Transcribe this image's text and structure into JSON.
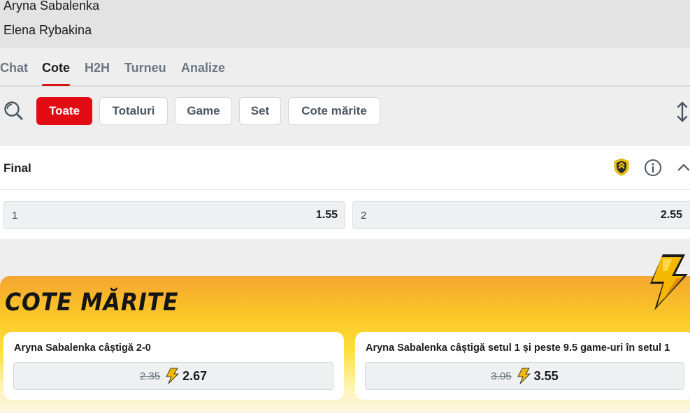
{
  "match": {
    "player1": "Aryna Sabalenka",
    "player2": "Elena Rybakina"
  },
  "tabs": [
    {
      "label": "Chat",
      "active": false
    },
    {
      "label": "Cote",
      "active": true
    },
    {
      "label": "H2H",
      "active": false
    },
    {
      "label": "Turneu",
      "active": false
    },
    {
      "label": "Analize",
      "active": false
    }
  ],
  "filters": [
    {
      "label": "Toate",
      "active": true
    },
    {
      "label": "Totaluri",
      "active": false
    },
    {
      "label": "Game",
      "active": false
    },
    {
      "label": "Set",
      "active": false
    },
    {
      "label": "Cote mărite",
      "active": false
    }
  ],
  "market": {
    "title": "Final",
    "selections": [
      {
        "label": "1",
        "odd": "1.55"
      },
      {
        "label": "2",
        "odd": "2.55"
      }
    ]
  },
  "boosted": {
    "title": "COTE MĂRITE",
    "cards": [
      {
        "title": "Aryna Sabalenka câștigă 2-0",
        "old_odd": "2.35",
        "new_odd": "2.67"
      },
      {
        "title": "Aryna Sabalenka câștigă setul 1 și peste 9.5 game-uri în setul 1",
        "old_odd": "3.05",
        "new_odd": "3.55"
      }
    ]
  },
  "icons": {
    "search": "search-icon",
    "sort": "sort-arrows-icon",
    "shield": "boost-shield-icon",
    "info": "info-icon",
    "collapse": "chevron-up-icon",
    "bolt": "lightning-bolt-icon"
  },
  "colors": {
    "accent": "#e20b13",
    "boost_yellow": "#fde03b",
    "boost_orange": "#f5a531",
    "bolt": "#f2b705"
  }
}
